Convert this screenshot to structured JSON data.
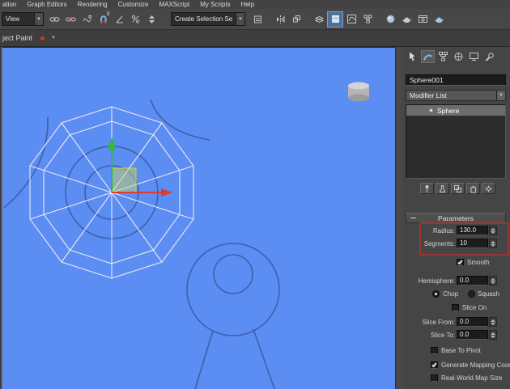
{
  "menu": {
    "items": [
      "ation",
      "Graph Editors",
      "Rendering",
      "Customize",
      "MAXScript",
      "My Scripts",
      "Help"
    ]
  },
  "toolbar": {
    "view_label": "View",
    "selection_set_label": "Create Selection Se",
    "snap_badge": "3",
    "icon_names": [
      "select-and-link",
      "unlink-selection",
      "bind-to-space-warp",
      "snap-toggle-3d",
      "angle-snap",
      "percent-snap",
      "spinner-snap",
      "edit-named-selection-sets",
      "mirror",
      "align",
      "layer-manager",
      "graphite-ribbon-toggle",
      "curve-editor",
      "schematic-view",
      "material-editor",
      "render-setup",
      "rendered-frame-window",
      "render-production"
    ]
  },
  "ribbon": {
    "tab_label": "ject Paint"
  },
  "icons": {
    "caret_down": "▼"
  },
  "command_panel": {
    "tabs": [
      "create",
      "modify",
      "hierarchy",
      "motion",
      "display",
      "utilities"
    ],
    "active_tab": "modify",
    "object_name": "Sphere001",
    "modifier_list_label": "Modifier List",
    "stack_items": [
      "Sphere"
    ],
    "stack_button_names": [
      "pin-stack",
      "show-end-result",
      "make-unique",
      "remove-modifier",
      "configure-modifier-sets"
    ],
    "parameters": {
      "title": "Parameters",
      "radius_label": "Radius:",
      "radius_value": "130.0",
      "segments_label": "Segments:",
      "segments_value": "10",
      "smooth_label": "Smooth",
      "smooth_checked": true,
      "hemisphere_label": "Hemisphere:",
      "hemisphere_value": "0.0",
      "chop_label": "Chop",
      "chop_selected": true,
      "squash_label": "Squash",
      "squash_selected": false,
      "slice_on_label": "Slice On",
      "slice_on_checked": false,
      "slice_from_label": "Slice From:",
      "slice_from_value": "0.0",
      "slice_to_label": "Slice To:",
      "slice_to_value": "0.0",
      "base_to_pivot_label": "Base To Pivot",
      "base_to_pivot_checked": false,
      "generate_mapping_label": "Generate Mapping Coord",
      "generate_mapping_checked": true,
      "real_world_label": "Real-World Map Size",
      "real_world_checked": false
    }
  },
  "colors": {
    "viewport_bg": "#5b8df2",
    "object_outline": "#3c61ad",
    "wireframe": "#ecebf2",
    "gizmo_x_axis": "#e03a2a",
    "gizmo_y_axis": "#2fbe2f",
    "tutorial_highlight": "#9a3535",
    "panel_bg": "#454545"
  }
}
